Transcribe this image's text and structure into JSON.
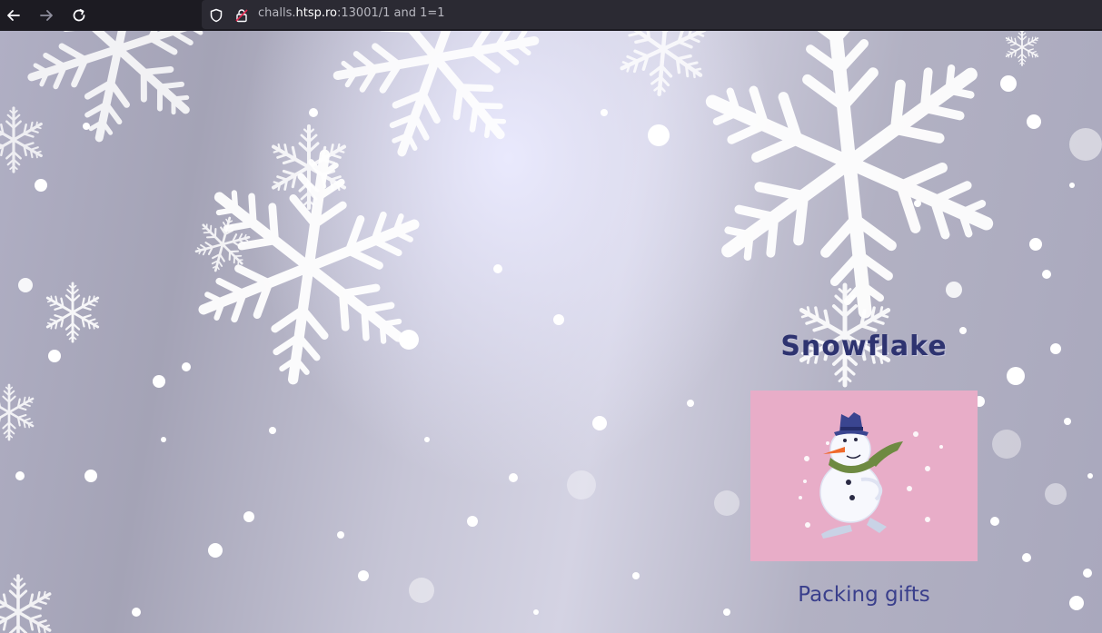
{
  "browser": {
    "url_prefix": "challs.",
    "url_host": "htsp.ro",
    "url_suffix": ":13001/1 and 1=1"
  },
  "page": {
    "title": "Snowflake",
    "card_caption": "Packing gifts"
  },
  "icons": [
    "back-arrow-icon",
    "forward-arrow-icon",
    "reload-icon",
    "shield-icon",
    "lock-icon"
  ]
}
